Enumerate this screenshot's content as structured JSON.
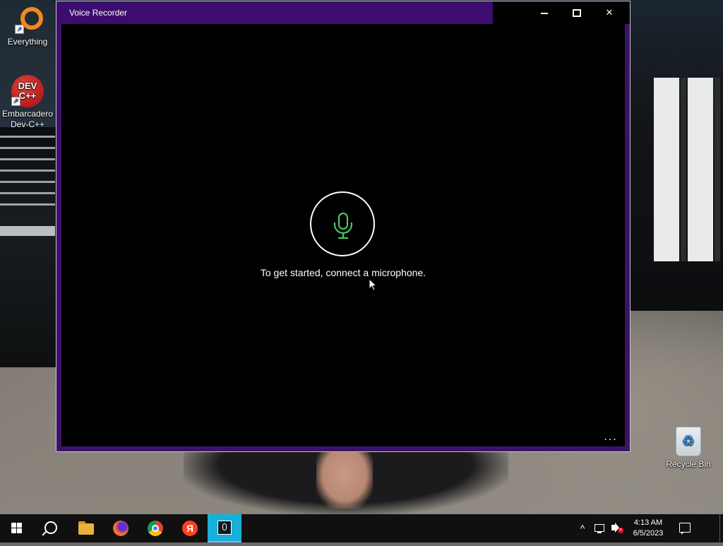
{
  "desktop": {
    "icons": [
      {
        "label": "Everything"
      },
      {
        "label": "Embarcadero Dev-C++",
        "glyph": "DEV C++"
      },
      {
        "label": "Recycle Bin"
      }
    ]
  },
  "window": {
    "title": "Voice Recorder",
    "accent_color": "#3c0d6e",
    "prompt": "To get started, connect a microphone.",
    "mic_color": "#49d36a",
    "more_label": "..."
  },
  "taskbar": {
    "apps": [
      {
        "name": "start",
        "icon": "windows-logo-icon"
      },
      {
        "name": "search",
        "icon": "search-icon"
      },
      {
        "name": "file-explorer",
        "icon": "folder-icon"
      },
      {
        "name": "firefox",
        "icon": "firefox-icon"
      },
      {
        "name": "chrome",
        "icon": "chrome-icon"
      },
      {
        "name": "yandex",
        "icon": "yandex-icon",
        "glyph": "Я"
      },
      {
        "name": "voice-recorder",
        "icon": "voice-recorder-icon",
        "active": true
      }
    ],
    "tray": {
      "chevron": "^",
      "time": "4:13 AM",
      "date": "6/5/2023"
    }
  }
}
